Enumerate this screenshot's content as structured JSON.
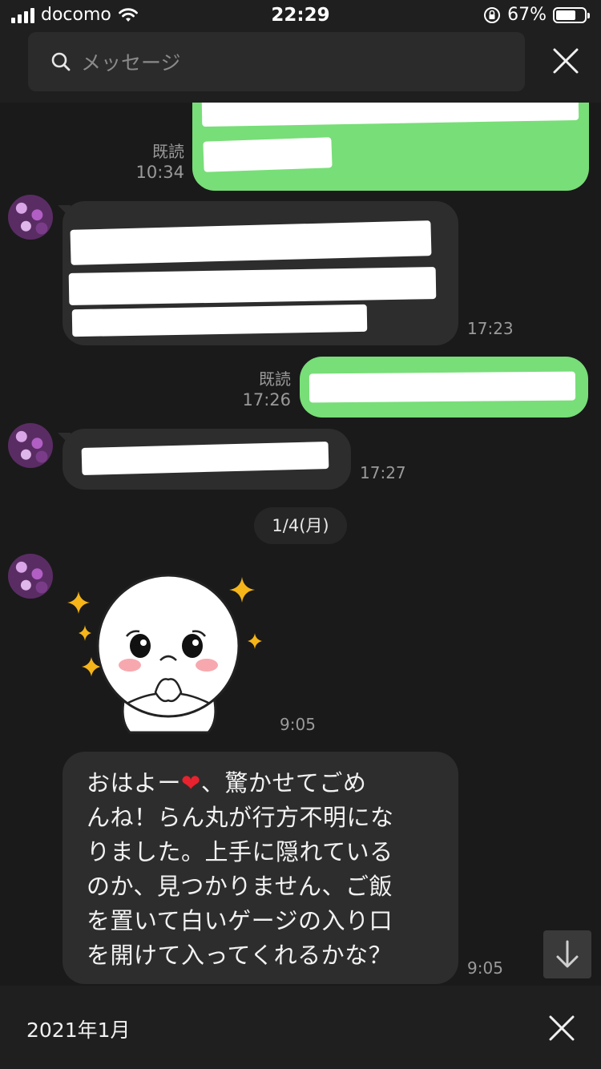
{
  "status_bar": {
    "carrier": "docomo",
    "time": "22:29",
    "battery": "67%",
    "battery_level": 0.67
  },
  "search": {
    "placeholder": "メッセージ"
  },
  "messages": {
    "m1": {
      "read": "既読",
      "time": "10:34"
    },
    "m2": {
      "time": "17:23"
    },
    "m3": {
      "read": "既読",
      "time": "17:26"
    },
    "m4": {
      "time": "17:27"
    },
    "date_separator": "1/4(月)",
    "m5": {
      "time": "9:05"
    },
    "m6": {
      "lines": [
        "おはよー",
        "、驚かせてごめ",
        "んね！らん丸が行方不明にな",
        "りました。上手に隠れている",
        "のか、見つかりません、ご飯",
        "を置いて白いゲージの入り口",
        "を開けて入ってくれるかな？"
      ],
      "emoji": "❤",
      "time": "9:05"
    }
  },
  "bottom_bar": {
    "month": "2021年1月"
  },
  "icons": [
    "search-icon",
    "close-icon",
    "arrow-down-icon",
    "wifi-icon",
    "signal-icon",
    "battery-icon",
    "rotation-lock-icon",
    "sticker"
  ],
  "colors": {
    "sent_bubble": "#78de78",
    "received_bubble": "#2d2d2d",
    "background": "#1a1a1a"
  }
}
